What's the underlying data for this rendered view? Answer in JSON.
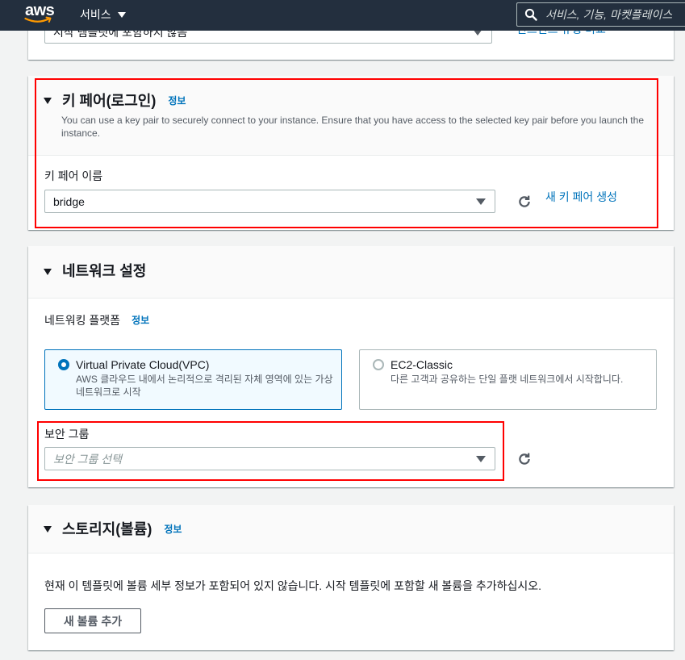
{
  "nav": {
    "logo_text": "aws",
    "services_label": "서비스",
    "search_placeholder": "서비스, 기능, 마켓플레이스"
  },
  "instance_type": {
    "select_value": "시작 템플릿에 포함하지 않음",
    "compare_link": "인스턴스 유형 비교"
  },
  "key_pair": {
    "title": "키 페어(로그인)",
    "info_label": "정보",
    "description": "You can use a key pair to securely connect to your instance. Ensure that you have access to the selected key pair before you launch the instance.",
    "field_label": "키 페어 이름",
    "select_value": "bridge",
    "create_link": "새 키 페어 생성"
  },
  "network": {
    "title": "네트워크 설정",
    "platform_label": "네트워킹 플랫폼",
    "info_label": "정보",
    "options": [
      {
        "title": "Virtual Private Cloud(VPC)",
        "description": "AWS 클라우드 내에서 논리적으로 격리된 자체 영역에 있는 가상 네트워크로 시작",
        "selected": true
      },
      {
        "title": "EC2-Classic",
        "description": "다른 고객과 공유하는 단일 플랫 네트워크에서 시작합니다.",
        "selected": false
      }
    ],
    "security_group_label": "보안 그룹",
    "security_group_placeholder": "보안 그룹 선택"
  },
  "storage": {
    "title": "스토리지(볼륨)",
    "info_label": "정보",
    "empty_message": "현재 이 템플릿에 볼륨 세부 정보가 포함되어 있지 않습니다. 시작 템플릿에 포함할 새 볼륨을 추가하십시오.",
    "add_button_label": "새 볼륨 추가"
  },
  "icons": {
    "logo": "aws-smile-logo",
    "services_caret": "caret-down-icon",
    "search": "search-icon",
    "section_toggle": "caret-down-icon",
    "select_caret": "caret-down-icon",
    "refresh": "refresh-icon"
  },
  "colors": {
    "nav_background": "#232f3e",
    "accent": "#0073bb",
    "logo_orange": "#ff9900",
    "annotation_red": "#ff0000",
    "page_background": "#f2f3f3"
  }
}
